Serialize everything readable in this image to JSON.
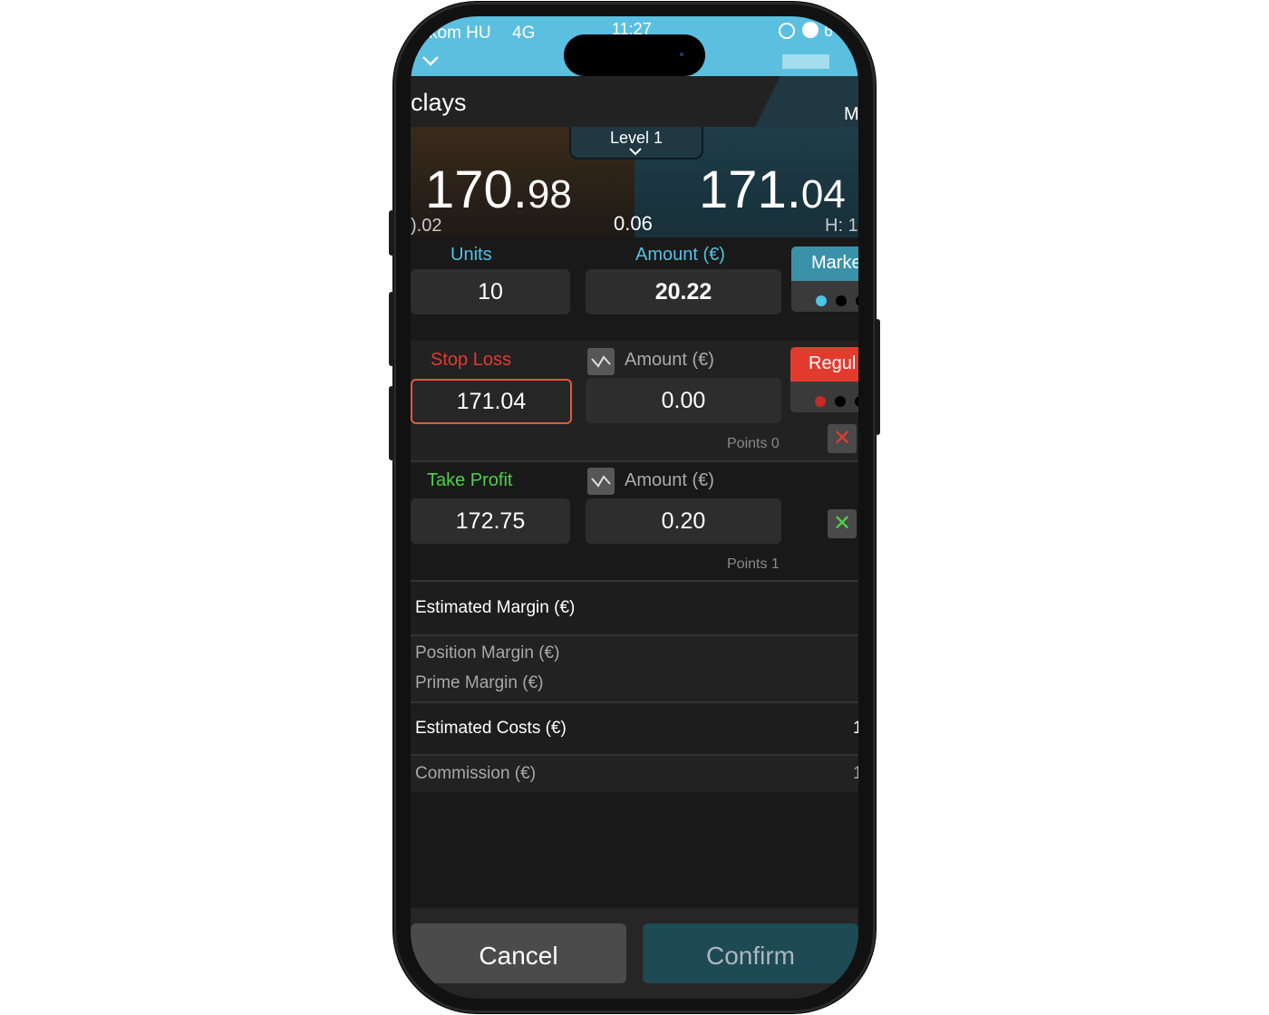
{
  "status_bar": {
    "carrier": "kom HU",
    "network": "4G",
    "time": "11:27",
    "battery_partial": "6"
  },
  "header": {
    "title": "clays",
    "right_partial": "M"
  },
  "quote": {
    "level_label": "Level 1",
    "bid_main": "170.",
    "bid_small": "98",
    "ask_main": "171.",
    "ask_small": "04",
    "spread": "0.06",
    "left_small": ").02",
    "high_label": "H: 1"
  },
  "order": {
    "units_label": "Units",
    "units_value": "10",
    "amount_label": "Amount (€)",
    "amount_value": "20.22",
    "order_type_partial": "Marke"
  },
  "stop_loss": {
    "label": "Stop Loss",
    "price": "171.04",
    "amount_label": "Amount (€)",
    "amount_value": "0.00",
    "mode_partial": "Regul",
    "points": "Points 0",
    "remove_symbol": "✕"
  },
  "take_profit": {
    "label": "Take Profit",
    "price": "172.75",
    "amount_label": "Amount (€)",
    "amount_value": "0.20",
    "points": "Points 1",
    "remove_symbol": "✕"
  },
  "margin": {
    "estimated_margin": "Estimated Margin (€)",
    "position_margin": "Position Margin (€)",
    "prime_margin": "Prime Margin (€)",
    "estimated_costs": "Estimated Costs (€)",
    "estimated_costs_partial": "1",
    "commission": "Commission (€)",
    "commission_partial": "1"
  },
  "actions": {
    "cancel": "Cancel",
    "confirm": "Confirm"
  },
  "colors": {
    "accent_blue": "#4fc3e8",
    "stop_red": "#e23b2e",
    "profit_green": "#4fd04a",
    "status_bar": "#5bbfe0"
  }
}
